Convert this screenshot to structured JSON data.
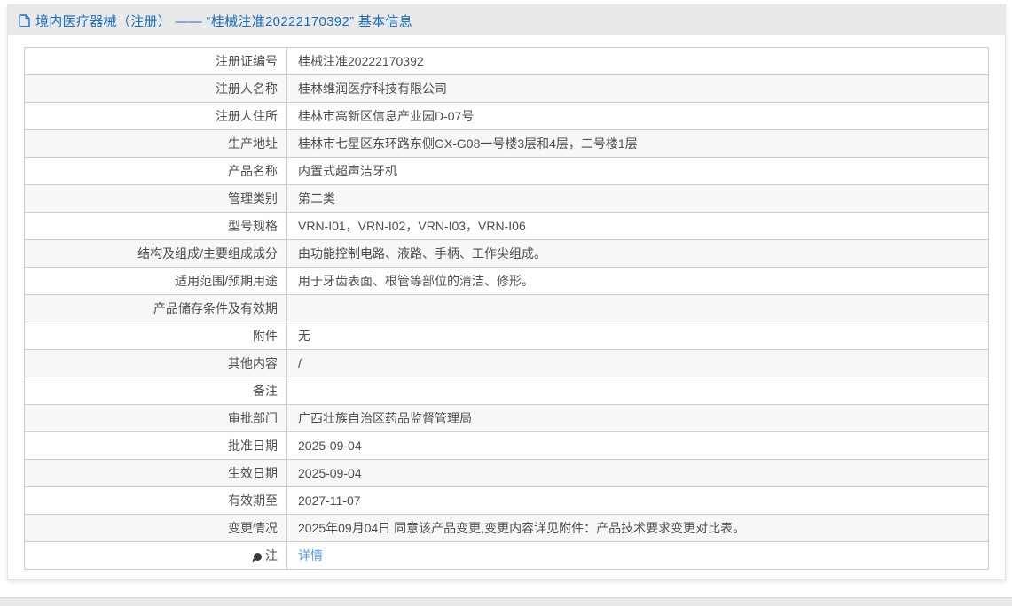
{
  "header": {
    "title": "境内医疗器械（注册） —— “桂械注准20222170392” 基本信息"
  },
  "table": {
    "rows": [
      {
        "label": "注册证编号",
        "value": "桂械注准20222170392"
      },
      {
        "label": "注册人名称",
        "value": "桂林维润医疗科技有限公司"
      },
      {
        "label": "注册人住所",
        "value": "桂林市高新区信息产业园D-07号"
      },
      {
        "label": "生产地址",
        "value": "桂林市七星区东环路东侧GX-G08一号楼3层和4层，二号楼1层"
      },
      {
        "label": "产品名称",
        "value": "内置式超声洁牙机"
      },
      {
        "label": "管理类别",
        "value": "第二类"
      },
      {
        "label": "型号规格",
        "value": "VRN-I01，VRN-I02，VRN-I03，VRN-I06"
      },
      {
        "label": "结构及组成/主要组成成分",
        "value": "由功能控制电路、液路、手柄、工作尖组成。"
      },
      {
        "label": "适用范围/预期用途",
        "value": "用于牙齿表面、根管等部位的清洁、修形。"
      },
      {
        "label": "产品储存条件及有效期",
        "value": ""
      },
      {
        "label": "附件",
        "value": "无"
      },
      {
        "label": "其他内容",
        "value": "/"
      },
      {
        "label": "备注",
        "value": ""
      },
      {
        "label": "审批部门",
        "value": "广西壮族自治区药品监督管理局"
      },
      {
        "label": "批准日期",
        "value": "2025-09-04"
      },
      {
        "label": "生效日期",
        "value": "2025-09-04"
      },
      {
        "label": "有效期至",
        "value": "2027-11-07"
      },
      {
        "label": "变更情况",
        "value": "2025年09月04日 同意该产品变更,变更内容详见附件：产品技术要求变更对比表。"
      },
      {
        "label": "注",
        "label_icon": "balloon-icon",
        "value": "详情",
        "value_is_link": true
      }
    ]
  },
  "colors": {
    "title_blue": "#176fc1",
    "link_blue": "#4f9ef0",
    "titlebar_bg": "#e9e9e9",
    "row_alt_bg": "#f7f7f7",
    "table_border": "#cccccc",
    "text": "#4d4d4d"
  }
}
